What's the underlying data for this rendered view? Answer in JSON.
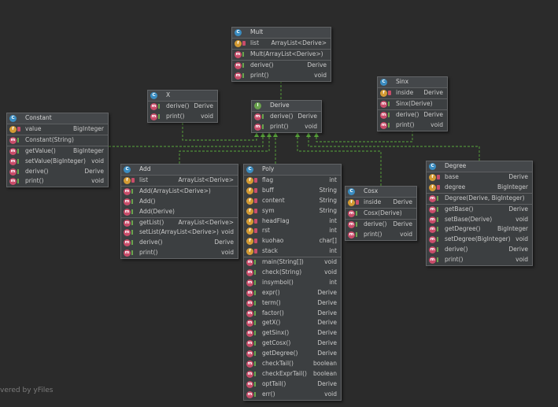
{
  "classes": [
    {
      "key": "mult",
      "kind": "c",
      "name": "Mult",
      "fields": [
        {
          "name": "list",
          "type": "ArrayList<Derive>"
        }
      ],
      "ctors": [
        {
          "name": "Mult(ArrayList<Derive>)",
          "type": ""
        }
      ],
      "methods": [
        {
          "name": "derive()",
          "type": "Derive"
        },
        {
          "name": "print()",
          "type": "void"
        }
      ]
    },
    {
      "key": "x",
      "kind": "c",
      "name": "X",
      "fields": [],
      "ctors": [],
      "methods": [
        {
          "name": "derive()",
          "type": "Derive"
        },
        {
          "name": "print()",
          "type": "void"
        }
      ]
    },
    {
      "key": "derive",
      "kind": "i",
      "name": "Derive",
      "fields": [],
      "ctors": [],
      "methods": [
        {
          "name": "derive()",
          "type": "Derive"
        },
        {
          "name": "print()",
          "type": "void"
        }
      ]
    },
    {
      "key": "sinx",
      "kind": "c",
      "name": "Sinx",
      "fields": [
        {
          "name": "inside",
          "type": "Derive"
        }
      ],
      "ctors": [
        {
          "name": "Sinx(Derive)",
          "type": ""
        }
      ],
      "methods": [
        {
          "name": "derive()",
          "type": "Derive"
        },
        {
          "name": "print()",
          "type": "void"
        }
      ]
    },
    {
      "key": "constant",
      "kind": "c",
      "name": "Constant",
      "fields": [
        {
          "name": "value",
          "type": "BigInteger"
        }
      ],
      "ctors": [
        {
          "name": "Constant(String)",
          "type": ""
        }
      ],
      "methods": [
        {
          "name": "getValue()",
          "type": "BigInteger"
        },
        {
          "name": "setValue(BigInteger)",
          "type": "void"
        },
        {
          "name": "derive()",
          "type": "Derive"
        },
        {
          "name": "print()",
          "type": "void"
        }
      ]
    },
    {
      "key": "add",
      "kind": "c",
      "name": "Add",
      "fields": [
        {
          "name": "list",
          "type": "ArrayList<Derive>"
        }
      ],
      "ctors": [
        {
          "name": "Add(ArrayList<Derive>)",
          "type": ""
        },
        {
          "name": "Add()",
          "type": ""
        },
        {
          "name": "Add(Derive)",
          "type": ""
        }
      ],
      "methods": [
        {
          "name": "getList()",
          "type": "ArrayList<Derive>"
        },
        {
          "name": "setList(ArrayList<Derive>)",
          "type": "void"
        },
        {
          "name": "derive()",
          "type": "Derive"
        },
        {
          "name": "print()",
          "type": "void"
        }
      ]
    },
    {
      "key": "poly",
      "kind": "c",
      "name": "Poly",
      "fields": [
        {
          "name": "flag",
          "type": "int"
        },
        {
          "name": "buff",
          "type": "String"
        },
        {
          "name": "content",
          "type": "String"
        },
        {
          "name": "sym",
          "type": "String"
        },
        {
          "name": "headFlag",
          "type": "int"
        },
        {
          "name": "rst",
          "type": "int"
        },
        {
          "name": "kuohao",
          "type": "char[]"
        },
        {
          "name": "stack",
          "type": "int"
        }
      ],
      "ctors": [],
      "methods": [
        {
          "name": "main(String[])",
          "type": "void"
        },
        {
          "name": "check(String)",
          "type": "void"
        },
        {
          "name": "insymbol()",
          "type": "int"
        },
        {
          "name": "expr()",
          "type": "Derive"
        },
        {
          "name": "term()",
          "type": "Derive"
        },
        {
          "name": "factor()",
          "type": "Derive"
        },
        {
          "name": "getX()",
          "type": "Derive"
        },
        {
          "name": "getSinx()",
          "type": "Derive"
        },
        {
          "name": "getCosx()",
          "type": "Derive"
        },
        {
          "name": "getDegree()",
          "type": "Derive"
        },
        {
          "name": "checkTail()",
          "type": "boolean"
        },
        {
          "name": "checkExprTail()",
          "type": "boolean"
        },
        {
          "name": "optTail()",
          "type": "Derive"
        },
        {
          "name": "err()",
          "type": "void"
        }
      ]
    },
    {
      "key": "cosx",
      "kind": "c",
      "name": "Cosx",
      "fields": [
        {
          "name": "inside",
          "type": "Derive"
        }
      ],
      "ctors": [
        {
          "name": "Cosx(Derive)",
          "type": ""
        }
      ],
      "methods": [
        {
          "name": "derive()",
          "type": "Derive"
        },
        {
          "name": "print()",
          "type": "void"
        }
      ]
    },
    {
      "key": "degree",
      "kind": "c",
      "name": "Degree",
      "fields": [
        {
          "name": "base",
          "type": "Derive"
        },
        {
          "name": "degree",
          "type": "BigInteger"
        }
      ],
      "ctors": [
        {
          "name": "Degree(Derive, BigInteger)",
          "type": ""
        }
      ],
      "methods": [
        {
          "name": "getBase()",
          "type": "Derive"
        },
        {
          "name": "setBase(Derive)",
          "type": "void"
        },
        {
          "name": "getDegree()",
          "type": "BigInteger"
        },
        {
          "name": "setDegree(BigInteger)",
          "type": "void"
        },
        {
          "name": "derive()",
          "type": "Derive"
        },
        {
          "name": "print()",
          "type": "void"
        }
      ]
    }
  ],
  "colors": {
    "background": "#2b2b2b",
    "box": "#3c3f41",
    "edge": "#5aa83c"
  },
  "watermark": "vered by yFiles"
}
